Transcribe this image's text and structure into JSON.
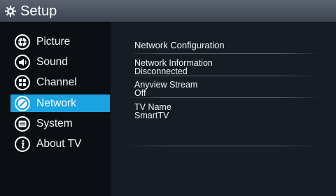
{
  "header": {
    "title": "Setup",
    "icon": "gear-icon"
  },
  "sidebar": {
    "items": [
      {
        "label": "Picture",
        "icon": "picture-icon",
        "active": false
      },
      {
        "label": "Sound",
        "icon": "sound-icon",
        "active": false
      },
      {
        "label": "Channel",
        "icon": "channel-icon",
        "active": false
      },
      {
        "label": "Network",
        "icon": "network-icon",
        "active": true
      },
      {
        "label": "System",
        "icon": "system-icon",
        "active": false
      },
      {
        "label": "About TV",
        "icon": "info-icon",
        "active": false
      }
    ]
  },
  "network": {
    "config_title": "Network Configuration",
    "info_label": "Network Information",
    "info_value": "Disconnected",
    "anyview_label": "Anyview Stream",
    "anyview_value": "Off",
    "tvname_label": "TV Name",
    "tvname_value": "SmartTV"
  },
  "colors": {
    "accent": "#1aa3e0",
    "header": "#4a525e",
    "panel": "#151c23"
  }
}
